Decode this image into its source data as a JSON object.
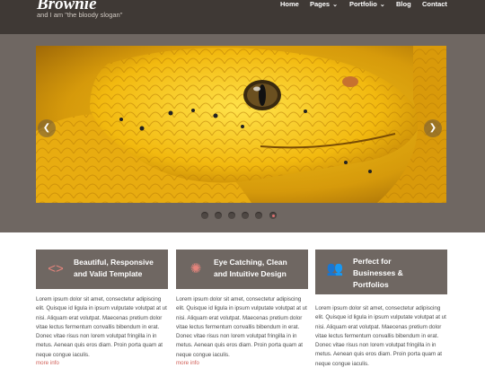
{
  "header": {
    "logo": "Brownie",
    "slogan": "and I am \"the bloody slogan\"",
    "nav": [
      {
        "label": "Home",
        "has_dropdown": false
      },
      {
        "label": "Pages",
        "has_dropdown": true
      },
      {
        "label": "Portfolio",
        "has_dropdown": true
      },
      {
        "label": "Blog",
        "has_dropdown": false
      },
      {
        "label": "Contact",
        "has_dropdown": false
      }
    ]
  },
  "slider": {
    "prev_icon": "chevron-left-icon",
    "next_icon": "chevron-right-icon",
    "prev_glyph": "❮",
    "next_glyph": "❯",
    "dot_count": 6,
    "active_dot": 6
  },
  "features": [
    {
      "icon": "code-icon",
      "icon_glyph": "<>",
      "title_line1": "Beautiful, Responsive",
      "title_line2": "and Valid Template",
      "title_line3": "",
      "text": "Lorem ipsum dolor sit amet, consectetur adipiscing elit. Quisque id ligula in ipsum vulputate volutpat at ut nisi. Aliquam erat volutpat. Maecenas pretium dolor vitae lectus fermentum convallis bibendum in erat. Donec vitae risus non lorem volutpat fringilla in in metus. Aenean quis eros diam. Proin porta quam at neque congue iaculis.",
      "more": "more info"
    },
    {
      "icon": "gear-icon",
      "icon_glyph": "✺",
      "title_line1": "Eye Catching, Clean",
      "title_line2": "and Intuitive Design",
      "title_line3": "",
      "text": "Lorem ipsum dolor sit amet, consectetur adipiscing elit. Quisque id ligula in ipsum vulputate volutpat at ut nisi. Aliquam erat volutpat. Maecenas pretium dolor vitae lectus fermentum convallis bibendum in erat. Donec vitae risus non lorem volutpat fringilla in in metus. Aenean quis eros diam. Proin porta quam at neque congue iaculis.",
      "more": "more info"
    },
    {
      "icon": "users-icon",
      "icon_glyph": "👥",
      "title_line1": "Perfect for",
      "title_line2": "Businesses &",
      "title_line3": "Portfolios",
      "text": "Lorem ipsum dolor sit amet, consectetur adipiscing elit. Quisque id ligula in ipsum vulputate volutpat at ut nisi. Aliquam erat volutpat. Maecenas pretium dolor vitae lectus fermentum convallis bibendum in erat. Donec vitae risus non lorem volutpat fringilla in in metus. Aenean quis eros diam. Proin porta quam at neque congue iaculis.",
      "more": ""
    }
  ]
}
